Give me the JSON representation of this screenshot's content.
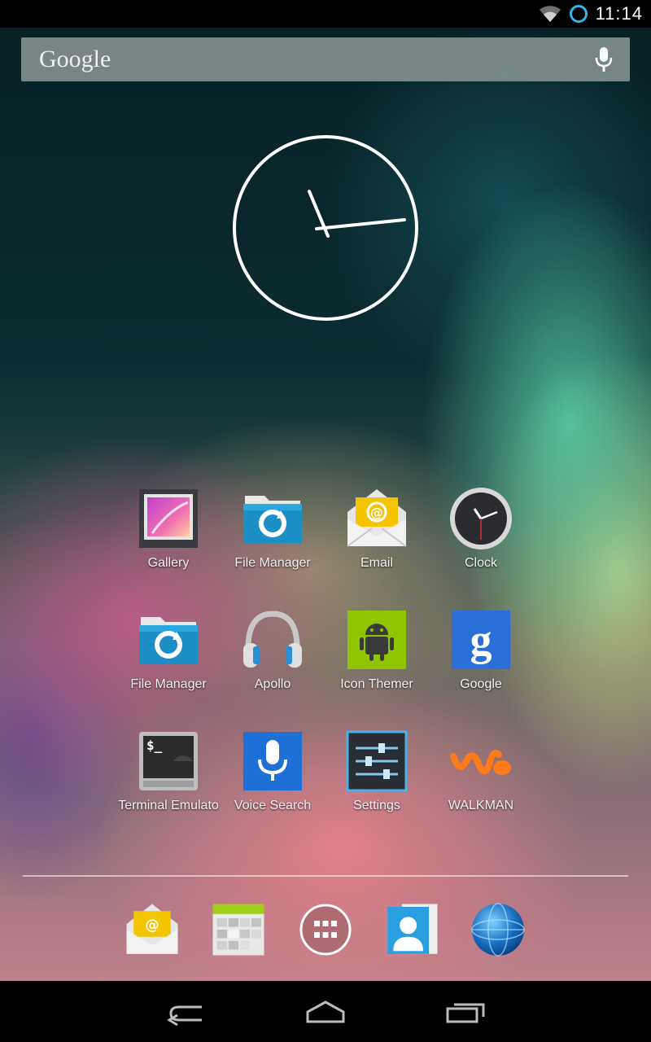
{
  "status": {
    "time": "11:14"
  },
  "search": {
    "logo": "Google"
  },
  "apps": [
    {
      "label": "Gallery",
      "icon": "gallery-icon"
    },
    {
      "label": "File Manager",
      "icon": "folder-sync-icon"
    },
    {
      "label": "Email",
      "icon": "email-icon"
    },
    {
      "label": "Clock",
      "icon": "clock-icon"
    },
    {
      "label": "File Manager",
      "icon": "folder-sync-icon"
    },
    {
      "label": "Apollo",
      "icon": "headphones-icon"
    },
    {
      "label": "Icon Themer",
      "icon": "android-icon"
    },
    {
      "label": "Google",
      "icon": "google-g-icon"
    },
    {
      "label": "Terminal Emulato",
      "icon": "terminal-icon"
    },
    {
      "label": "Voice Search",
      "icon": "microphone-icon"
    },
    {
      "label": "Settings",
      "icon": "sliders-icon"
    },
    {
      "label": "WALKMAN",
      "icon": "walkman-icon"
    }
  ],
  "dock": [
    "email-icon",
    "calendar-icon",
    "app-drawer-icon",
    "contacts-icon",
    "browser-globe-icon"
  ],
  "nav": [
    "back-icon",
    "home-icon",
    "recent-apps-icon"
  ],
  "colors": {
    "accent": "#33b5e5",
    "status_bar": "#000000",
    "nav_bar": "#000000"
  }
}
